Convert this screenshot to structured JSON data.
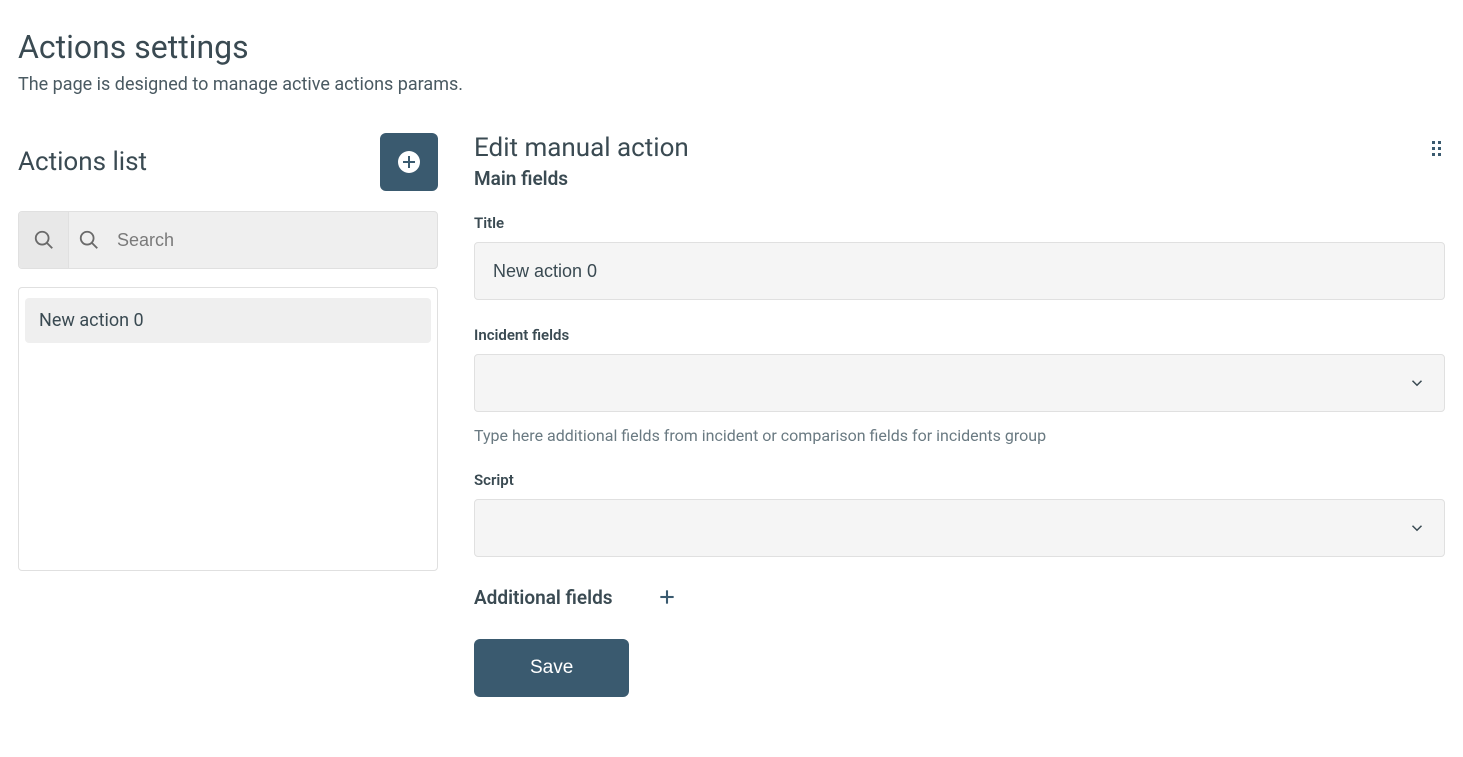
{
  "header": {
    "title": "Actions settings",
    "subtitle": "The page is designed to manage active actions params."
  },
  "sidebar": {
    "title": "Actions list",
    "search_placeholder": "Search",
    "items": [
      {
        "label": "New action 0"
      }
    ]
  },
  "main": {
    "title": "Edit manual action",
    "section_main_fields": "Main fields",
    "title_field": {
      "label": "Title",
      "value": "New action 0"
    },
    "incident_field": {
      "label": "Incident fields",
      "value": "",
      "helper": "Type here additional fields from incident or comparison fields for incidents group"
    },
    "script_field": {
      "label": "Script",
      "value": ""
    },
    "additional_section": "Additional fields",
    "save_label": "Save"
  },
  "colors": {
    "accent": "#3a5a6f",
    "text": "#3a4a52",
    "muted_bg": "#f5f5f5",
    "border": "#e0e0e0"
  }
}
